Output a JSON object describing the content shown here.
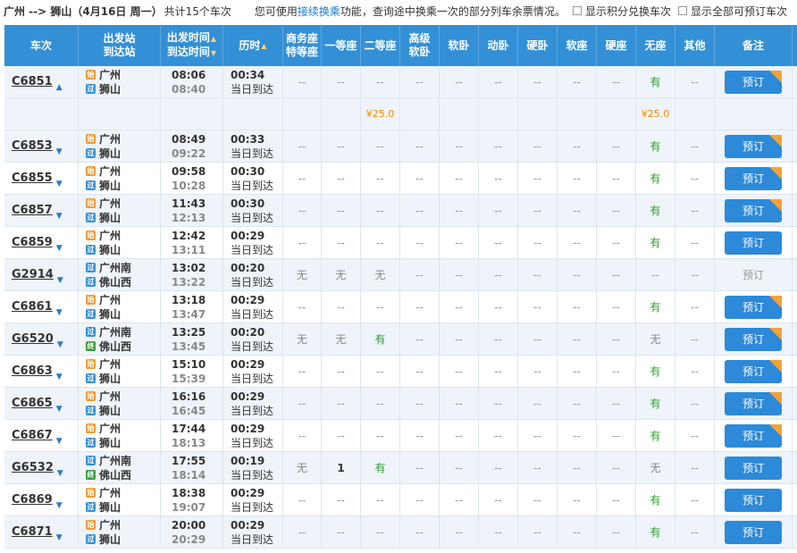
{
  "topbar": {
    "route": "广州 --> 狮山",
    "date": "（4月16日  周一）",
    "count": "共计15个车次",
    "notice_pre": "您可使用",
    "notice_link": "接续换乘",
    "notice_post": "功能，查询途中换乘一次的部分列车余票情况。",
    "cb1": "显示积分兑换车次",
    "cb2": "显示全部可预订车次"
  },
  "header": {
    "train": "车次",
    "station_a": "出发站",
    "station_b": "到达站",
    "time_a": "出发时间",
    "time_b": "到达时间",
    "duration": "历时",
    "business_a": "商务座",
    "business_b": "特等座",
    "first": "一等座",
    "second": "二等座",
    "hsleeper_a": "高级",
    "hsleeper_b": "软卧",
    "soft_sleeper": "软卧",
    "moving_sleeper": "动卧",
    "hard_sleeper": "硬卧",
    "soft_seat": "软座",
    "hard_seat": "硬座",
    "no_seat": "无座",
    "other": "其他",
    "remark": "备注",
    "sort_up": "▲",
    "sort_down": "▼"
  },
  "book_label": "预订",
  "price_row": {
    "second": "¥25.0",
    "no_seat": "¥25.0"
  },
  "trains": [
    {
      "no": "C6851",
      "arrow": "▲",
      "from": "广州",
      "from_tag": "始",
      "to": "狮山",
      "to_tag": "过",
      "dep": "08:06",
      "arr": "08:40",
      "dur": "00:34",
      "note": "当日到达",
      "seats": [
        "--",
        "--",
        "--",
        "--",
        "--",
        "--",
        "--",
        "--",
        "--",
        "有",
        "--"
      ],
      "badge": true,
      "bookable": true
    },
    {
      "no": "C6853",
      "arrow": "▼",
      "from": "广州",
      "from_tag": "始",
      "to": "狮山",
      "to_tag": "过",
      "dep": "08:49",
      "arr": "09:22",
      "dur": "00:33",
      "note": "当日到达",
      "seats": [
        "--",
        "--",
        "--",
        "--",
        "--",
        "--",
        "--",
        "--",
        "--",
        "有",
        "--"
      ],
      "badge": true,
      "bookable": true
    },
    {
      "no": "C6855",
      "arrow": "▼",
      "from": "广州",
      "from_tag": "始",
      "to": "狮山",
      "to_tag": "过",
      "dep": "09:58",
      "arr": "10:28",
      "dur": "00:30",
      "note": "当日到达",
      "seats": [
        "--",
        "--",
        "--",
        "--",
        "--",
        "--",
        "--",
        "--",
        "--",
        "有",
        "--"
      ],
      "badge": true,
      "bookable": true
    },
    {
      "no": "C6857",
      "arrow": "▼",
      "from": "广州",
      "from_tag": "始",
      "to": "狮山",
      "to_tag": "过",
      "dep": "11:43",
      "arr": "12:13",
      "dur": "00:30",
      "note": "当日到达",
      "seats": [
        "--",
        "--",
        "--",
        "--",
        "--",
        "--",
        "--",
        "--",
        "--",
        "有",
        "--"
      ],
      "badge": true,
      "bookable": true
    },
    {
      "no": "C6859",
      "arrow": "▼",
      "from": "广州",
      "from_tag": "始",
      "to": "狮山",
      "to_tag": "过",
      "dep": "12:42",
      "arr": "13:11",
      "dur": "00:29",
      "note": "当日到达",
      "seats": [
        "--",
        "--",
        "--",
        "--",
        "--",
        "--",
        "--",
        "--",
        "--",
        "有",
        "--"
      ],
      "badge": false,
      "bookable": true
    },
    {
      "no": "G2914",
      "arrow": "▼",
      "from": "广州南",
      "from_tag": "过",
      "to": "佛山西",
      "to_tag": "过",
      "dep": "13:02",
      "arr": "13:22",
      "dur": "00:20",
      "note": "当日到达",
      "seats": [
        "无",
        "无",
        "无",
        "--",
        "--",
        "--",
        "--",
        "--",
        "--",
        "--",
        "--"
      ],
      "badge": false,
      "bookable": false
    },
    {
      "no": "C6861",
      "arrow": "▼",
      "from": "广州",
      "from_tag": "始",
      "to": "狮山",
      "to_tag": "过",
      "dep": "13:18",
      "arr": "13:47",
      "dur": "00:29",
      "note": "当日到达",
      "seats": [
        "--",
        "--",
        "--",
        "--",
        "--",
        "--",
        "--",
        "--",
        "--",
        "有",
        "--"
      ],
      "badge": true,
      "bookable": true
    },
    {
      "no": "G6520",
      "arrow": "▼",
      "from": "广州南",
      "from_tag": "过",
      "to": "佛山西",
      "to_tag": "终",
      "dep": "13:25",
      "arr": "13:45",
      "dur": "00:20",
      "note": "当日到达",
      "seats": [
        "无",
        "无",
        "有",
        "--",
        "--",
        "--",
        "--",
        "--",
        "--",
        "无",
        "--"
      ],
      "badge": true,
      "bookable": true
    },
    {
      "no": "C6863",
      "arrow": "▼",
      "from": "广州",
      "from_tag": "始",
      "to": "狮山",
      "to_tag": "过",
      "dep": "15:10",
      "arr": "15:39",
      "dur": "00:29",
      "note": "当日到达",
      "seats": [
        "--",
        "--",
        "--",
        "--",
        "--",
        "--",
        "--",
        "--",
        "--",
        "有",
        "--"
      ],
      "badge": true,
      "bookable": true
    },
    {
      "no": "C6865",
      "arrow": "▼",
      "from": "广州",
      "from_tag": "始",
      "to": "狮山",
      "to_tag": "过",
      "dep": "16:16",
      "arr": "16:45",
      "dur": "00:29",
      "note": "当日到达",
      "seats": [
        "--",
        "--",
        "--",
        "--",
        "--",
        "--",
        "--",
        "--",
        "--",
        "有",
        "--"
      ],
      "badge": true,
      "bookable": true
    },
    {
      "no": "C6867",
      "arrow": "▼",
      "from": "广州",
      "from_tag": "始",
      "to": "狮山",
      "to_tag": "过",
      "dep": "17:44",
      "arr": "18:13",
      "dur": "00:29",
      "note": "当日到达",
      "seats": [
        "--",
        "--",
        "--",
        "--",
        "--",
        "--",
        "--",
        "--",
        "--",
        "有",
        "--"
      ],
      "badge": true,
      "bookable": true
    },
    {
      "no": "G6532",
      "arrow": "▼",
      "from": "广州南",
      "from_tag": "过",
      "to": "佛山西",
      "to_tag": "终",
      "dep": "17:55",
      "arr": "18:14",
      "dur": "00:19",
      "note": "当日到达",
      "seats": [
        "无",
        "1",
        "有",
        "--",
        "--",
        "--",
        "--",
        "--",
        "--",
        "无",
        "--"
      ],
      "badge": false,
      "bookable": true
    },
    {
      "no": "C6869",
      "arrow": "▼",
      "from": "广州",
      "from_tag": "始",
      "to": "狮山",
      "to_tag": "过",
      "dep": "18:38",
      "arr": "19:07",
      "dur": "00:29",
      "note": "当日到达",
      "seats": [
        "--",
        "--",
        "--",
        "--",
        "--",
        "--",
        "--",
        "--",
        "--",
        "有",
        "--"
      ],
      "badge": false,
      "bookable": true
    },
    {
      "no": "C6871",
      "arrow": "▼",
      "from": "广州",
      "from_tag": "始",
      "to": "狮山",
      "to_tag": "过",
      "dep": "20:00",
      "arr": "20:29",
      "dur": "00:29",
      "note": "当日到达",
      "seats": [
        "--",
        "--",
        "--",
        "--",
        "--",
        "--",
        "--",
        "--",
        "--",
        "有",
        "--"
      ],
      "badge": false,
      "bookable": true
    }
  ]
}
